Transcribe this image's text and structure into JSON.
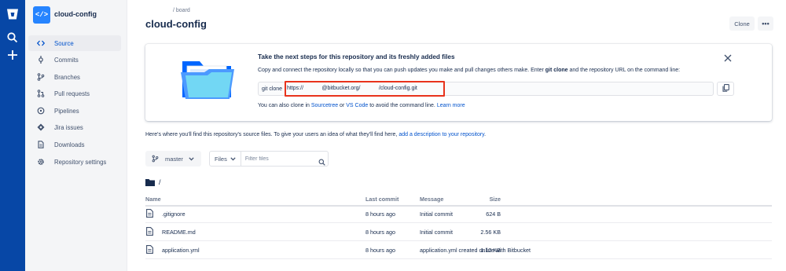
{
  "global_nav": {
    "logo": "bitbucket-logo-icon",
    "items": [
      {
        "icon": "search-icon"
      },
      {
        "icon": "plus-icon"
      }
    ]
  },
  "sidebar": {
    "repo_name": "cloud-config",
    "avatar_text": "</>",
    "items": [
      {
        "label": "Source",
        "icon": "code-icon",
        "active": true
      },
      {
        "label": "Commits",
        "icon": "commit-icon"
      },
      {
        "label": "Branches",
        "icon": "branch-icon"
      },
      {
        "label": "Pull requests",
        "icon": "pull-request-icon"
      },
      {
        "label": "Pipelines",
        "icon": "pipelines-icon"
      },
      {
        "label": "Jira issues",
        "icon": "jira-icon"
      },
      {
        "label": "Downloads",
        "icon": "document-icon"
      },
      {
        "label": "Repository settings",
        "icon": "gear-icon"
      }
    ]
  },
  "header": {
    "breadcrumb": "/   board",
    "title": "cloud-config",
    "clone_label": "Clone",
    "more_label": "•••"
  },
  "panel": {
    "title": "Take the next steps for this repository and its freshly added files",
    "desc_pre": "Copy and connect the repository locally so that you can push updates you make and pull changes others make. Enter ",
    "desc_bold": "git clone",
    "desc_post": " and the repository URL on the command line:",
    "clone_prefix": "git clone",
    "clone_url": "https://            @bitbucket.org/            /cloud-config.git",
    "alt_pre": "You can also clone in ",
    "alt_link1": "Sourcetree",
    "alt_mid": " or ",
    "alt_link2": "VS Code",
    "alt_post": " to avoid the command line. ",
    "alt_link3": "Learn more"
  },
  "intro": {
    "text": "Here's where you'll find this repository's source files. To give your users an idea of what they'll find here, ",
    "link": "add a description to your repository",
    "end": "."
  },
  "toolbar": {
    "branch": "master",
    "files_label": "Files",
    "filter_placeholder": "Filter files"
  },
  "path": "/",
  "table": {
    "headers": {
      "name": "Name",
      "size": "Size",
      "last_commit": "Last commit",
      "message": "Message"
    },
    "rows": [
      {
        "name": ".gitignore",
        "size": "624 B",
        "last_commit": "8 hours ago",
        "message": "Initial commit"
      },
      {
        "name": "README.md",
        "size": "2.56 KB",
        "last_commit": "8 hours ago",
        "message": "Initial commit"
      },
      {
        "name": "application.yml",
        "size": "1.12 KB",
        "last_commit": "8 hours ago",
        "message": "application.yml created online with Bitbucket"
      }
    ]
  },
  "colors": {
    "global_nav": "#0747a6",
    "link": "#0052cc",
    "highlight_box": "#e8331c",
    "folder": "#2684ff"
  }
}
